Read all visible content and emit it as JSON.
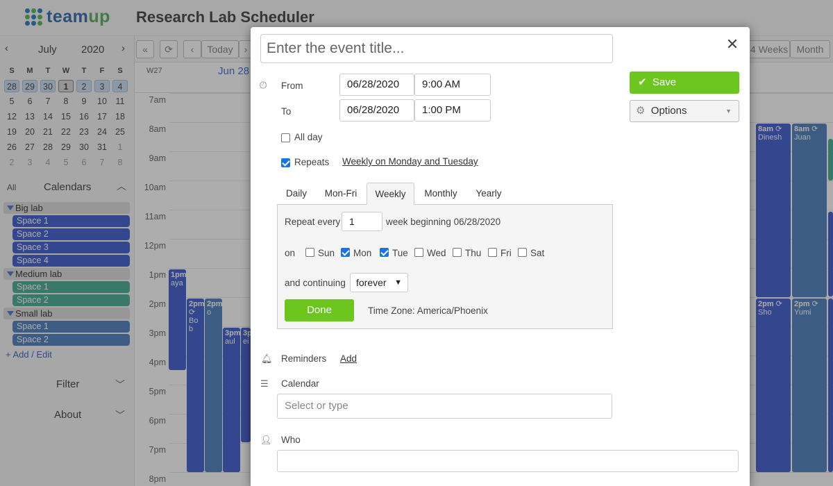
{
  "app": {
    "logo_word_a": "team",
    "logo_word_b": "up",
    "title": "Research Lab Scheduler"
  },
  "mini_calendar": {
    "month": "July",
    "year": "2020",
    "weekday_headers": [
      "S",
      "M",
      "T",
      "W",
      "T",
      "F",
      "S"
    ],
    "weeks": [
      [
        "28",
        "29",
        "30",
        "1",
        "2",
        "3",
        "4"
      ],
      [
        "5",
        "6",
        "7",
        "8",
        "9",
        "10",
        "11"
      ],
      [
        "12",
        "13",
        "14",
        "15",
        "16",
        "17",
        "18"
      ],
      [
        "19",
        "20",
        "21",
        "22",
        "23",
        "24",
        "25"
      ],
      [
        "26",
        "27",
        "28",
        "29",
        "30",
        "31",
        "1"
      ],
      [
        "2",
        "3",
        "4",
        "5",
        "6",
        "7",
        "8"
      ]
    ]
  },
  "sidebar": {
    "all_label": "All",
    "calendars_label": "Calendars",
    "groups": [
      {
        "name": "Big lab",
        "items": [
          "Space 1",
          "Space 2",
          "Space 3",
          "Space 4"
        ],
        "color": "#2f4fc9"
      },
      {
        "name": "Medium lab",
        "items": [
          "Space 1",
          "Space 2"
        ],
        "color": "#3aa58a"
      },
      {
        "name": "Small lab",
        "items": [
          "Space 1",
          "Space 2"
        ],
        "color": "#3f74b8"
      }
    ],
    "add_edit": "+ Add / Edit",
    "filter_label": "Filter",
    "about_label": "About"
  },
  "toolbar": {
    "today": "Today",
    "view_4weeks": "4 Weeks",
    "view_month": "Month"
  },
  "grid": {
    "week_label": "W27",
    "day_label": "Jun 28",
    "hours": [
      "7am",
      "8am",
      "9am",
      "10am",
      "11am",
      "12pm",
      "1pm",
      "2pm",
      "3pm",
      "4pm",
      "5pm",
      "6pm",
      "7pm",
      "8pm"
    ],
    "events": {
      "aya": {
        "time": "1pm",
        "name": "aya"
      },
      "bob": {
        "time": "2pm",
        "name": "Bo b"
      },
      "o": {
        "time": "2pm",
        "name": "o"
      },
      "aul": {
        "time": "3pm",
        "name": "aul"
      },
      "ei": {
        "time": "3p",
        "name": "ei"
      },
      "dinesh": {
        "time": "8am",
        "name": "Dinesh"
      },
      "juan": {
        "time": "8am",
        "name": "Juan"
      },
      "sho": {
        "time": "2pm",
        "name": "Sho"
      },
      "yumi": {
        "time": "2pm",
        "name": "Yumi"
      }
    }
  },
  "dialog": {
    "title_placeholder": "Enter the event title...",
    "from_label": "From",
    "to_label": "To",
    "from_date": "06/28/2020",
    "from_time": "9:00 AM",
    "to_date": "06/28/2020",
    "to_time": "1:00 PM",
    "all_day_label": "All day",
    "repeats_label": "Repeats",
    "repeats_summary": "Weekly on Monday and Tuesday",
    "tabs": [
      "Daily",
      "Mon-Fri",
      "Weekly",
      "Monthly",
      "Yearly"
    ],
    "active_tab": "Weekly",
    "repeat_every_label": "Repeat every",
    "repeat_every_value": "1",
    "week_beginning": "week beginning 06/28/2020",
    "on_label": "on",
    "weekdays": [
      {
        "label": "Sun",
        "checked": false
      },
      {
        "label": "Mon",
        "checked": true
      },
      {
        "label": "Tue",
        "checked": true
      },
      {
        "label": "Wed",
        "checked": false
      },
      {
        "label": "Thu",
        "checked": false
      },
      {
        "label": "Fri",
        "checked": false
      },
      {
        "label": "Sat",
        "checked": false
      }
    ],
    "continuing_label": "and continuing",
    "continuing_value": "forever",
    "done_label": "Done",
    "timezone": "Time Zone: America/Phoenix",
    "reminders_label": "Reminders",
    "reminders_add": "Add",
    "calendar_label": "Calendar",
    "calendar_placeholder": "Select or type",
    "who_label": "Who",
    "save_label": "Save",
    "options_label": "Options",
    "accent_green": "#6cc61d"
  }
}
